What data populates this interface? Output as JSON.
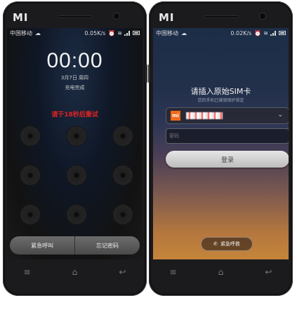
{
  "left_phone": {
    "brand_logo": "MI",
    "status": {
      "carrier": "中国移动",
      "speed": "0.05K/s"
    },
    "clock_time": "00:00",
    "date": "3月7日 周四",
    "charge_status": "充电完成",
    "warning": "请于18秒后重试",
    "lock_buttons": {
      "emergency": "紧急呼叫",
      "forgot": "忘记密码"
    }
  },
  "right_phone": {
    "brand_logo": "MI",
    "status": {
      "carrier": "中国移动",
      "speed": "0.02K/s"
    },
    "title": "请插入原始SIM卡",
    "subtitle": "您的手机已被锁保护锁定",
    "account_badge": "mi",
    "password_placeholder": "密码",
    "login_label": "登录",
    "emergency_label": "紧急呼救"
  },
  "nav_icons": [
    "menu-icon",
    "home-icon",
    "back-icon"
  ],
  "colors": {
    "warning_red": "#e32222",
    "mi_orange": "#f06a1b"
  }
}
